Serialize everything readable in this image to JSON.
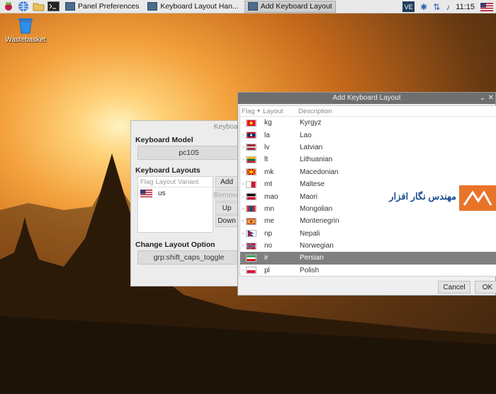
{
  "taskbar": {
    "tasks": [
      {
        "label": "Panel Preferences"
      },
      {
        "label": "Keyboard Layout Han..."
      },
      {
        "label": "Add Keyboard Layout"
      }
    ],
    "tray": {
      "clock": "11:15",
      "ve_label": "VE"
    }
  },
  "desktop": {
    "wastebasket_label": "Wastebasket"
  },
  "keyboard_window": {
    "title_fragment": "Keyboar",
    "model_label": "Keyboard Model",
    "model_value": "pc105",
    "layouts_label": "Keyboard Layouts",
    "list_headers": {
      "flag": "Flag",
      "layout": "Layout",
      "variant": "Variant"
    },
    "layouts": [
      {
        "code": "us"
      }
    ],
    "buttons": {
      "add": "Add",
      "remove": "Remove",
      "up": "Up",
      "down": "Down"
    },
    "option_label": "Change Layout Option",
    "option_value": "grp:shift_caps_toggle"
  },
  "dialog": {
    "title": "Add Keyboard Layout",
    "headers": {
      "flag": "Flag",
      "layout": "Layout",
      "description": "Description"
    },
    "rows": [
      {
        "code": "kg",
        "desc": "Kyrgyz",
        "flag": "kg"
      },
      {
        "code": "la",
        "desc": "Lao",
        "flag": "la"
      },
      {
        "code": "lv",
        "desc": "Latvian",
        "flag": "lv"
      },
      {
        "code": "lt",
        "desc": "Lithuanian",
        "flag": "lt"
      },
      {
        "code": "mk",
        "desc": "Macedonian",
        "flag": "mk"
      },
      {
        "code": "mt",
        "desc": "Maltese",
        "flag": "mt"
      },
      {
        "code": "mao",
        "desc": "Maori",
        "flag": "mao"
      },
      {
        "code": "mn",
        "desc": "Mongolian",
        "flag": "mn"
      },
      {
        "code": "me",
        "desc": "Montenegrin",
        "flag": "me"
      },
      {
        "code": "np",
        "desc": "Nepali",
        "flag": "np"
      },
      {
        "code": "no",
        "desc": "Norwegian",
        "flag": "no"
      },
      {
        "code": "ir",
        "desc": "Persian",
        "flag": "ir",
        "selected": true
      },
      {
        "code": "pl",
        "desc": "Polish",
        "flag": "pl"
      }
    ],
    "buttons": {
      "cancel": "Cancel",
      "ok": "OK"
    }
  },
  "watermark": {
    "text": "مهندس نگار افزار"
  },
  "colors": {
    "selection": "#7f7f7f",
    "title_bar": "#6e6e6e",
    "taskbar": "#e9e9e9"
  }
}
